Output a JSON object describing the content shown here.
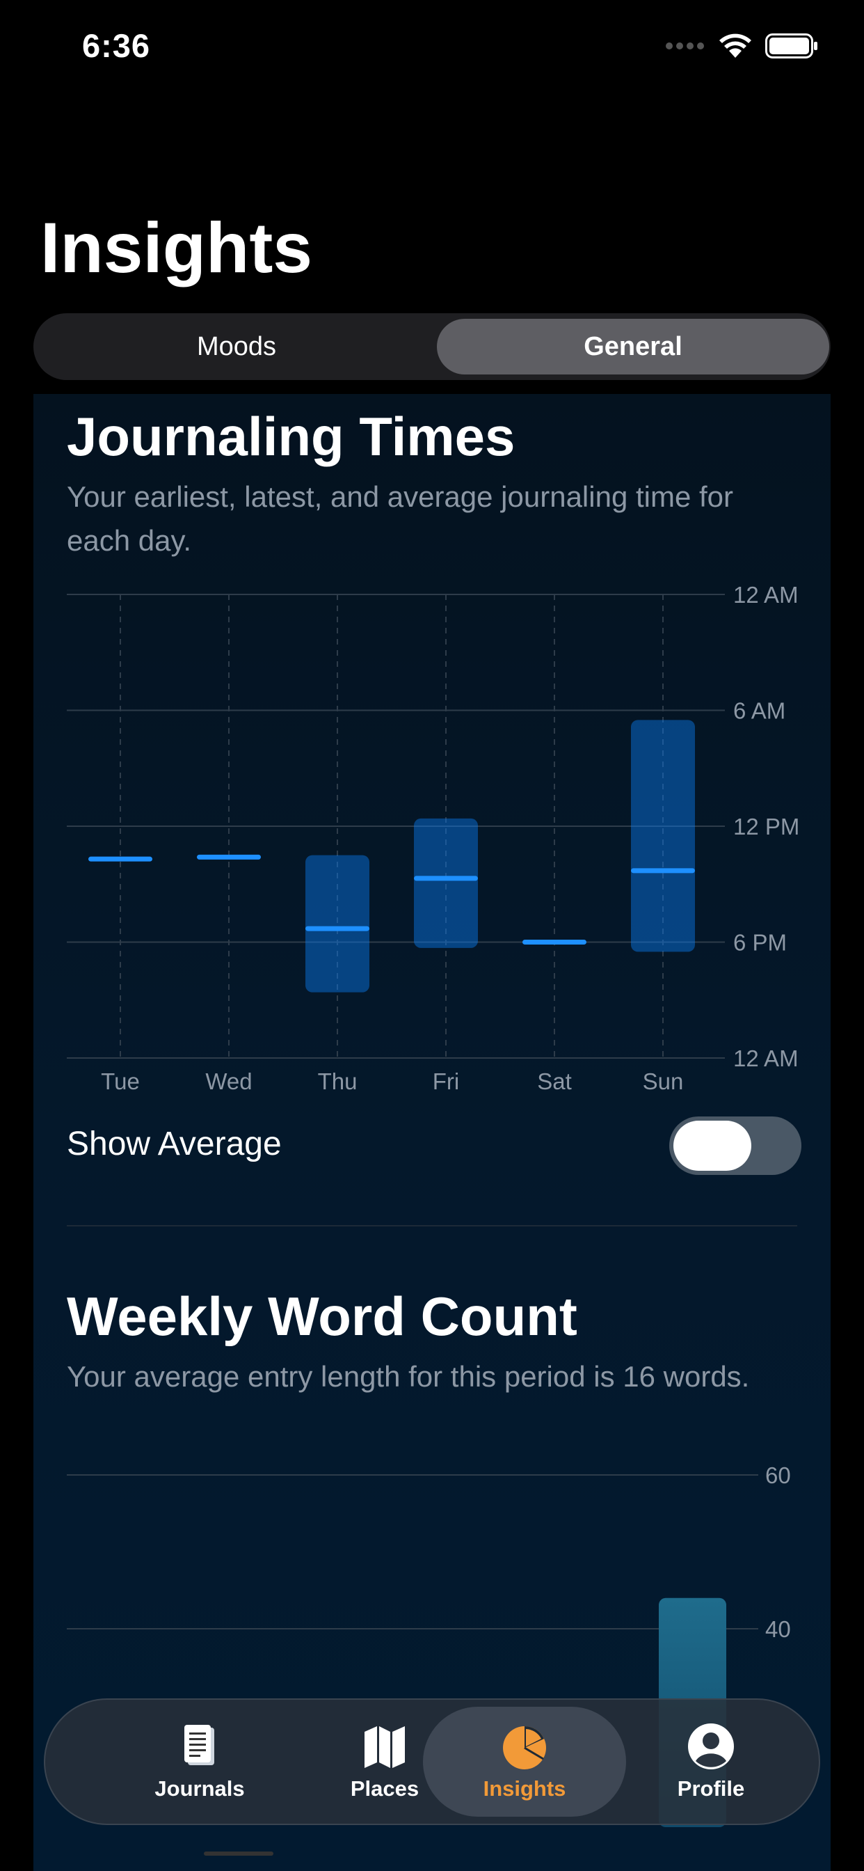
{
  "status": {
    "time": "6:36"
  },
  "header": {
    "title": "Insights"
  },
  "segmented": {
    "options": [
      "Moods",
      "General"
    ],
    "selected": "General"
  },
  "journaling_times": {
    "title": "Journaling Times",
    "description": "Your earliest, latest, and average journaling time for each day.",
    "show_average_label": "Show Average",
    "show_average": true
  },
  "weekly_word_count": {
    "title": "Weekly Word Count",
    "description": "Your average entry length for this period is 16 words."
  },
  "chart_data": [
    {
      "type": "bar",
      "title": "Journaling Times",
      "categories": [
        "Tue",
        "Wed",
        "Thu",
        "Fri",
        "Sat",
        "Sun"
      ],
      "y_tick_labels": [
        "12 AM",
        "6 AM",
        "12 PM",
        "6 PM",
        "12 AM"
      ],
      "y_unit": "hours from midnight",
      "ylim": [
        0,
        24
      ],
      "range_series": [
        {
          "name": "earliest",
          "values": [
            13.7,
            13.6,
            13.5,
            11.6,
            18.0,
            6.5
          ]
        },
        {
          "name": "latest",
          "values": [
            13.7,
            13.6,
            20.6,
            18.3,
            18.0,
            18.5
          ]
        }
      ],
      "series": [
        {
          "name": "average",
          "values": [
            13.7,
            13.6,
            17.3,
            14.7,
            18.0,
            14.3
          ]
        }
      ],
      "grid": true,
      "color": "#0a84ff"
    },
    {
      "type": "bar",
      "title": "Weekly Word Count",
      "y_tick_labels": [
        "60",
        "40"
      ],
      "ylim": [
        20,
        60
      ],
      "series": [
        {
          "values": [
            44
          ]
        }
      ],
      "grid": true,
      "color": "#2a9fd6"
    }
  ],
  "tabbar": {
    "tabs": [
      {
        "label": "Journals",
        "icon": "journal-icon"
      },
      {
        "label": "Places",
        "icon": "map-icon"
      },
      {
        "label": "Insights",
        "icon": "pie-chart-icon"
      },
      {
        "label": "Profile",
        "icon": "person-icon"
      }
    ],
    "active": "Insights",
    "accent": "#f29a38"
  }
}
